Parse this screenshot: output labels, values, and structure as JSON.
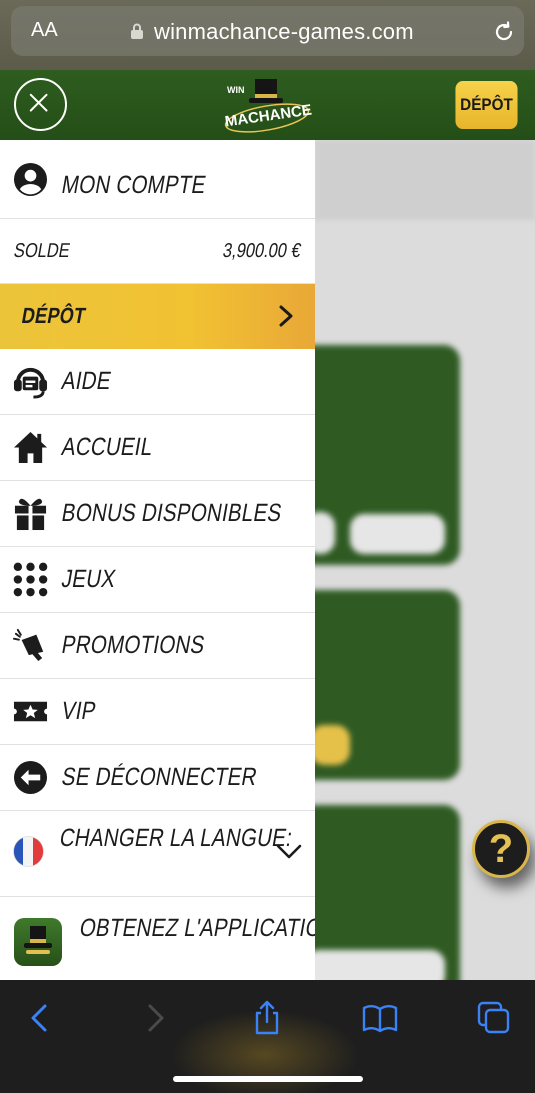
{
  "browser": {
    "text_size_label": "AA",
    "url": "winmachance-games.com"
  },
  "header": {
    "logo_top": "WIN",
    "logo_main": "MACHANCE",
    "depot_button": "DÉPÔT"
  },
  "menu": {
    "account": "MON COMPTE",
    "balance_label": "SOLDE",
    "balance_value": "3,900.00 €",
    "deposit": "DÉPÔT",
    "items": [
      {
        "label": "AIDE",
        "icon": "headset-icon"
      },
      {
        "label": "ACCUEIL",
        "icon": "home-icon"
      },
      {
        "label": "BONUS DISPONIBLES",
        "icon": "gift-icon"
      },
      {
        "label": "JEUX",
        "icon": "grid-dots-icon"
      },
      {
        "label": "PROMOTIONS",
        "icon": "megaphone-icon"
      },
      {
        "label": "VIP",
        "icon": "ticket-star-icon"
      },
      {
        "label": "SE DÉCONNECTER",
        "icon": "logout-icon"
      }
    ],
    "language_label": "CHANGER LA LANGUE:",
    "language_flag": "flag-france-icon",
    "get_app": "OBTENEZ L'APPLICATION"
  },
  "help_button": "?",
  "colors": {
    "header_green": "#2e5d1f",
    "deposit_yellow": "#f1c232",
    "safari_blue": "#3b82f6"
  }
}
